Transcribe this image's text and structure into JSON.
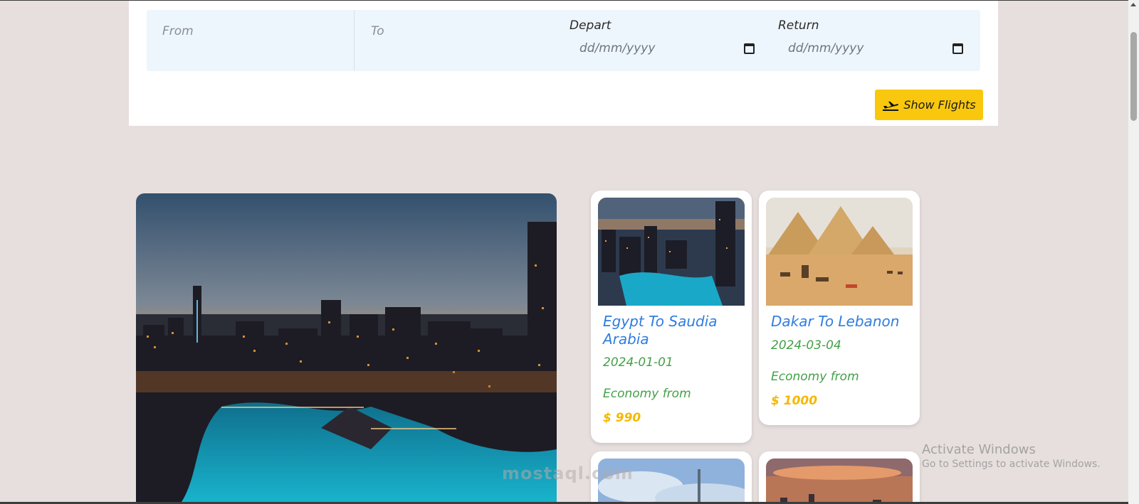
{
  "search": {
    "from_placeholder": "From",
    "to_placeholder": "To",
    "depart_label": "Depart",
    "depart_value": "dd/mm/yyyy",
    "return_label": "Return",
    "return_value": "dd/mm/yyyy",
    "show_button_label": "Show Flights",
    "show_button_icon": "plane-departure-icon"
  },
  "cards": [
    {
      "title": "Egypt To Saudia Arabia",
      "date": "2024-01-01",
      "economy_label": "Economy from",
      "price": "$ 990"
    },
    {
      "title": "Dakar To Lebanon",
      "date": "2024-03-04",
      "economy_label": "Economy from",
      "price": "$ 1000"
    }
  ],
  "watermark": {
    "windows_title": "Activate Windows",
    "windows_subtitle": "Go to Settings to activate Windows.",
    "site": "mostaql.com"
  },
  "colors": {
    "page_bg": "#e7dfde",
    "accent_yellow": "#f9c70e",
    "title_blue": "#2e7de0",
    "text_green": "#43a047",
    "price_gold": "#f5b800"
  }
}
